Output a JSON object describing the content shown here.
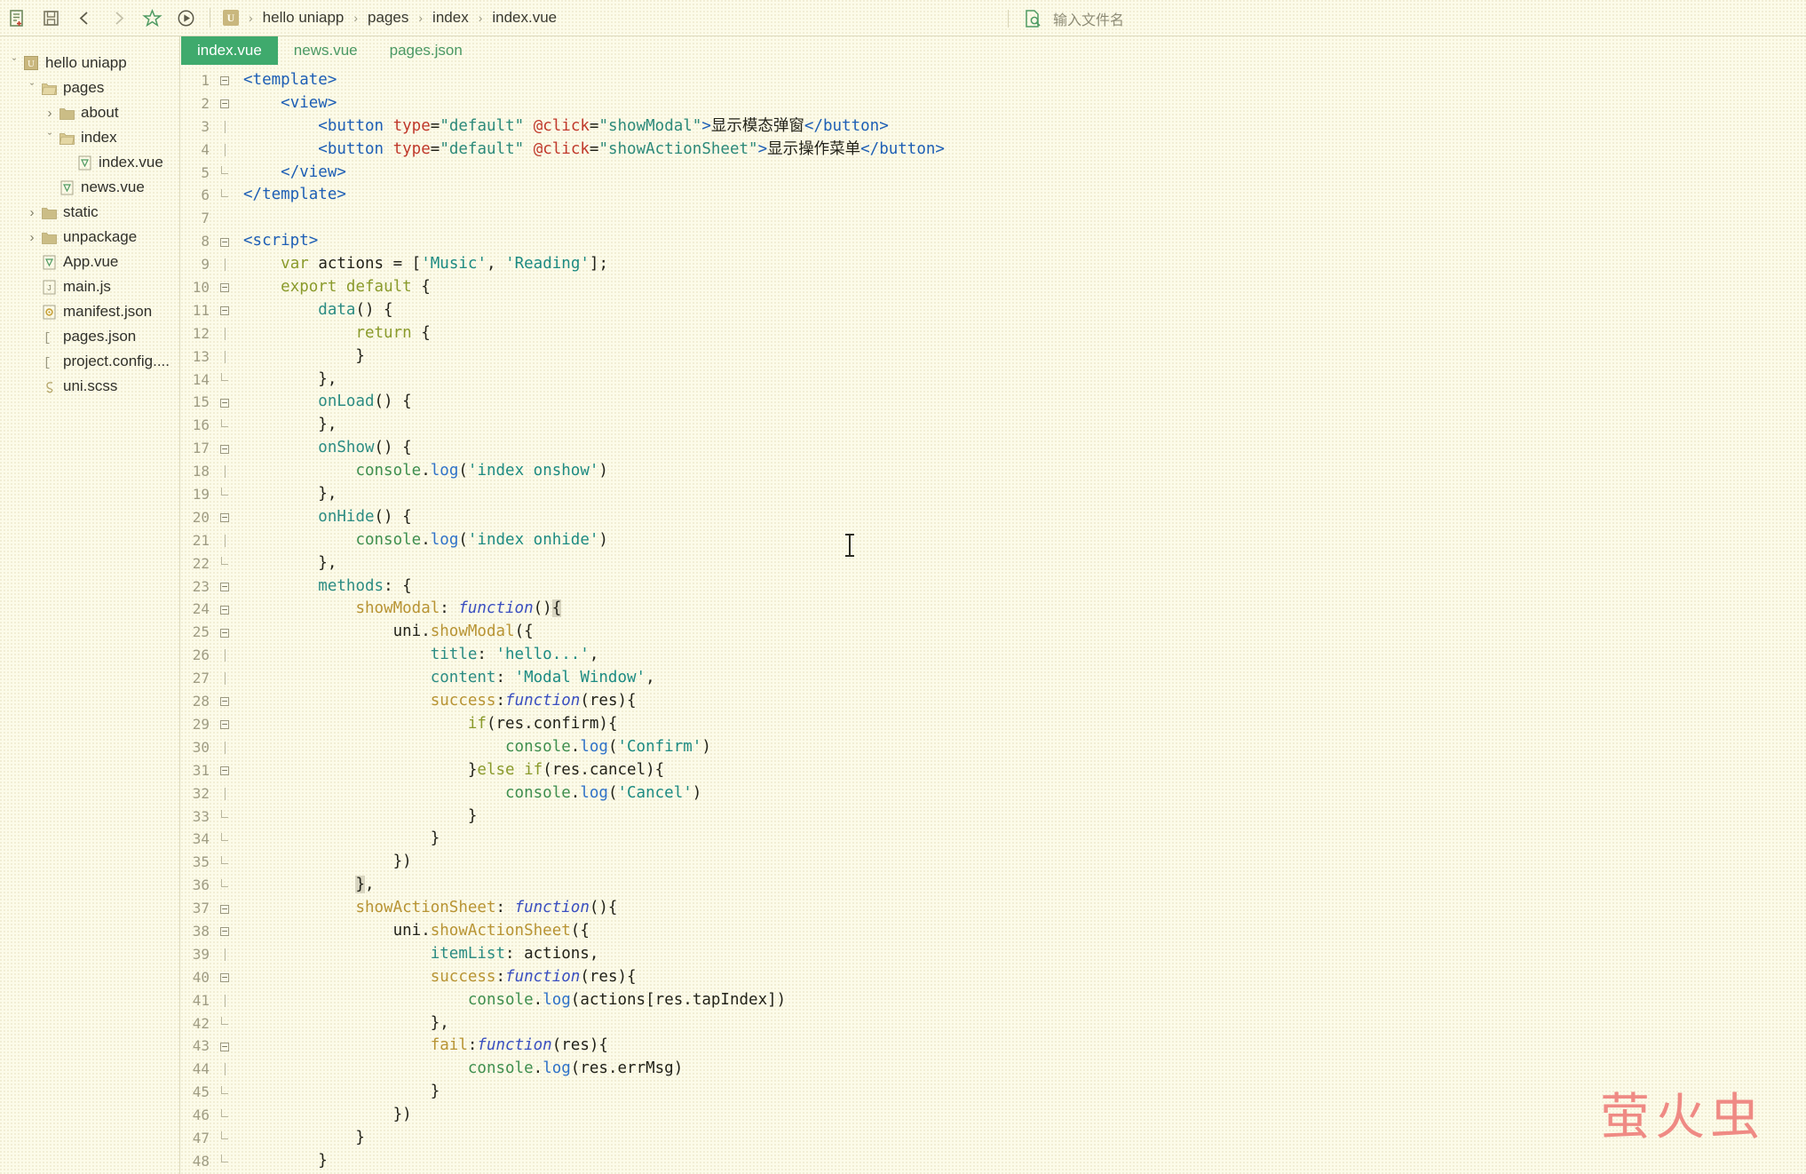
{
  "toolbar": {
    "buttons": [
      {
        "name": "new-file-icon",
        "title": "新建"
      },
      {
        "name": "save-icon",
        "title": "保存"
      },
      {
        "name": "back-arrow-icon",
        "title": "后退"
      },
      {
        "name": "forward-arrow-icon",
        "title": "前进"
      },
      {
        "name": "star-icon",
        "title": "收藏"
      },
      {
        "name": "run-icon",
        "title": "运行"
      }
    ],
    "breadcrumb": [
      "hello uniapp",
      "pages",
      "index",
      "index.vue"
    ],
    "breadcrumb_separator": "›",
    "project_badge": "U",
    "search_icon": "file-search-icon",
    "search_placeholder": "输入文件名"
  },
  "sidebar": {
    "items": [
      {
        "label": "hello uniapp",
        "indent": 0,
        "twisty": "ⱟ",
        "icon": "uniapp-project-icon"
      },
      {
        "label": "pages",
        "indent": 1,
        "twisty": "ⱟ",
        "icon": "folder-open-icon"
      },
      {
        "label": "about",
        "indent": 2,
        "twisty": "›",
        "icon": "folder-icon"
      },
      {
        "label": "index",
        "indent": 2,
        "twisty": "ⱟ",
        "icon": "folder-open-icon"
      },
      {
        "label": "index.vue",
        "indent": 3,
        "twisty": "",
        "icon": "vue-file-icon"
      },
      {
        "label": "news.vue",
        "indent": 2,
        "twisty": "",
        "icon": "vue-file-icon"
      },
      {
        "label": "static",
        "indent": 1,
        "twisty": "›",
        "icon": "folder-icon"
      },
      {
        "label": "unpackage",
        "indent": 1,
        "twisty": "›",
        "icon": "folder-icon"
      },
      {
        "label": "App.vue",
        "indent": 1,
        "twisty": "",
        "icon": "vue-file-icon"
      },
      {
        "label": "main.js",
        "indent": 1,
        "twisty": "",
        "icon": "js-file-icon"
      },
      {
        "label": "manifest.json",
        "indent": 1,
        "twisty": "",
        "icon": "manifest-json-icon"
      },
      {
        "label": "pages.json",
        "indent": 1,
        "twisty": "",
        "icon": "json-file-icon"
      },
      {
        "label": "project.config....",
        "indent": 1,
        "twisty": "",
        "icon": "json-file-icon"
      },
      {
        "label": "uni.scss",
        "indent": 1,
        "twisty": "",
        "icon": "scss-file-icon"
      }
    ]
  },
  "tabs": [
    {
      "label": "index.vue",
      "active": true
    },
    {
      "label": "news.vue",
      "active": false
    },
    {
      "label": "pages.json",
      "active": false
    }
  ],
  "editor": {
    "file": "index.vue",
    "first_line": 1,
    "last_visible_line": 48,
    "colors": {
      "background": "#fcfbe9",
      "tag": "#1e5fb5",
      "attribute": "#c0392b",
      "string": "#1d8b82",
      "keyword": "#8a9a2b",
      "function_keyword": "#3a4fc0",
      "property": "#2c8c83",
      "method_name": "#b89434",
      "console_object": "#3f8f4f",
      "log_method": "#2f72c8",
      "line_number": "#a09d84",
      "active_tab": "#3faa6d"
    },
    "lines": [
      {
        "n": 1,
        "fold": "box"
      },
      {
        "n": 2,
        "fold": "box"
      },
      {
        "n": 3,
        "fold": "bar"
      },
      {
        "n": 4,
        "fold": "bar"
      },
      {
        "n": 5,
        "fold": "elbow"
      },
      {
        "n": 6,
        "fold": "elbow"
      },
      {
        "n": 7,
        "fold": ""
      },
      {
        "n": 8,
        "fold": "box"
      },
      {
        "n": 9,
        "fold": "bar"
      },
      {
        "n": 10,
        "fold": "box"
      },
      {
        "n": 11,
        "fold": "box"
      },
      {
        "n": 12,
        "fold": "bar"
      },
      {
        "n": 13,
        "fold": "bar"
      },
      {
        "n": 14,
        "fold": "elbow"
      },
      {
        "n": 15,
        "fold": "box"
      },
      {
        "n": 16,
        "fold": "elbow"
      },
      {
        "n": 17,
        "fold": "box"
      },
      {
        "n": 18,
        "fold": "bar"
      },
      {
        "n": 19,
        "fold": "elbow"
      },
      {
        "n": 20,
        "fold": "box"
      },
      {
        "n": 21,
        "fold": "bar"
      },
      {
        "n": 22,
        "fold": "elbow"
      },
      {
        "n": 23,
        "fold": "box"
      },
      {
        "n": 24,
        "fold": "box"
      },
      {
        "n": 25,
        "fold": "box"
      },
      {
        "n": 26,
        "fold": "bar"
      },
      {
        "n": 27,
        "fold": "bar"
      },
      {
        "n": 28,
        "fold": "box"
      },
      {
        "n": 29,
        "fold": "box"
      },
      {
        "n": 30,
        "fold": "bar"
      },
      {
        "n": 31,
        "fold": "box"
      },
      {
        "n": 32,
        "fold": "bar"
      },
      {
        "n": 33,
        "fold": "elbow"
      },
      {
        "n": 34,
        "fold": "elbow"
      },
      {
        "n": 35,
        "fold": "elbow"
      },
      {
        "n": 36,
        "fold": "elbow"
      },
      {
        "n": 37,
        "fold": "box"
      },
      {
        "n": 38,
        "fold": "box"
      },
      {
        "n": 39,
        "fold": "bar"
      },
      {
        "n": 40,
        "fold": "box"
      },
      {
        "n": 41,
        "fold": "bar"
      },
      {
        "n": 42,
        "fold": "elbow"
      },
      {
        "n": 43,
        "fold": "box"
      },
      {
        "n": 44,
        "fold": "bar"
      },
      {
        "n": 45,
        "fold": "elbow"
      },
      {
        "n": 46,
        "fold": "elbow"
      },
      {
        "n": 47,
        "fold": "elbow"
      },
      {
        "n": 48,
        "fold": "elbow"
      }
    ],
    "source_text": [
      "<template>",
      "    <view>",
      "        <button type=\"default\" @click=\"showModal\">显示模态弹窗</button>",
      "        <button type=\"default\" @click=\"showActionSheet\">显示操作菜单</button>",
      "    </view>",
      "</template>",
      "",
      "<script>",
      "    var actions = ['Music', 'Reading'];",
      "    export default {",
      "        data() {",
      "            return {",
      "            }",
      "        },",
      "        onLoad() {",
      "        },",
      "        onShow() {",
      "            console.log('index onshow')",
      "        },",
      "        onHide() {",
      "            console.log('index onhide')",
      "        },",
      "        methods: {",
      "            showModal: function(){",
      "                uni.showModal({",
      "                    title: 'hello...',",
      "                    content: 'Modal Window',",
      "                    success:function(res){",
      "                        if(res.confirm){",
      "                            console.log('Confirm')",
      "                        }else if(res.cancel){",
      "                            console.log('Cancel')",
      "                        }",
      "                    }",
      "                })",
      "            },",
      "            showActionSheet: function(){",
      "                uni.showActionSheet({",
      "                    itemList: actions,",
      "                    success:function(res){",
      "                        console.log(actions[res.tapIndex])",
      "                    },",
      "                    fail:function(res){",
      "                        console.log(res.errMsg)",
      "                    }",
      "                })",
      "            }",
      "        }"
    ]
  },
  "watermark": "萤火虫"
}
